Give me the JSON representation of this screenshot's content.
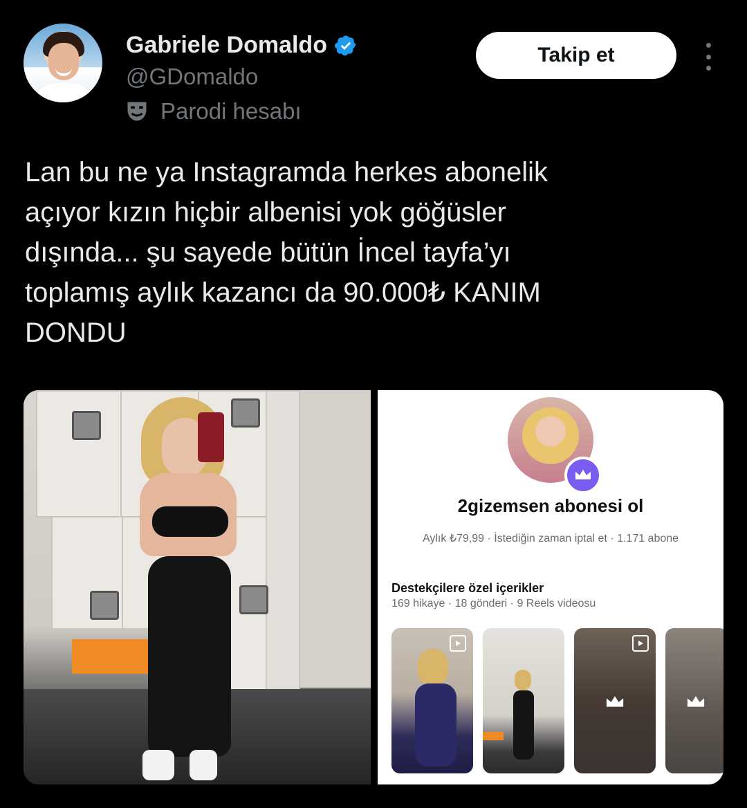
{
  "author": {
    "name": "Gabriele Domaldo",
    "handle": "@GDomaldo",
    "parody_label": "Parodi hesabı",
    "verified": true
  },
  "actions": {
    "follow_label": "Takip et"
  },
  "tweet": {
    "text": "Lan bu ne ya Instagramda herkes abonelik\naçıyor kızın hiçbir albenisi yok göğüsler\ndışında... şu sayede bütün İncel tayfa’yı\ntoplamış aylık kazancı da 90.000₺ KANIM\nDONDU"
  },
  "media": {
    "instagram": {
      "title": "2gizemsen abonesi ol",
      "subtitle": "Aylık ₺79,99 · İstediğin zaman iptal et · 1.171 abone",
      "section_title": "Destekçilere özel içerikler",
      "section_sub": "169 hikaye · 18 gönderi · 9 Reels videosu"
    }
  },
  "colors": {
    "background": "#000000",
    "text": "#e7e9ea",
    "muted": "#71767b",
    "verified": "#1d9bf0",
    "crown_badge": "#7b5cf0"
  },
  "icons": [
    "verified-badge-icon",
    "parody-mask-icon",
    "more-options-icon",
    "crown-icon",
    "play-icon"
  ]
}
